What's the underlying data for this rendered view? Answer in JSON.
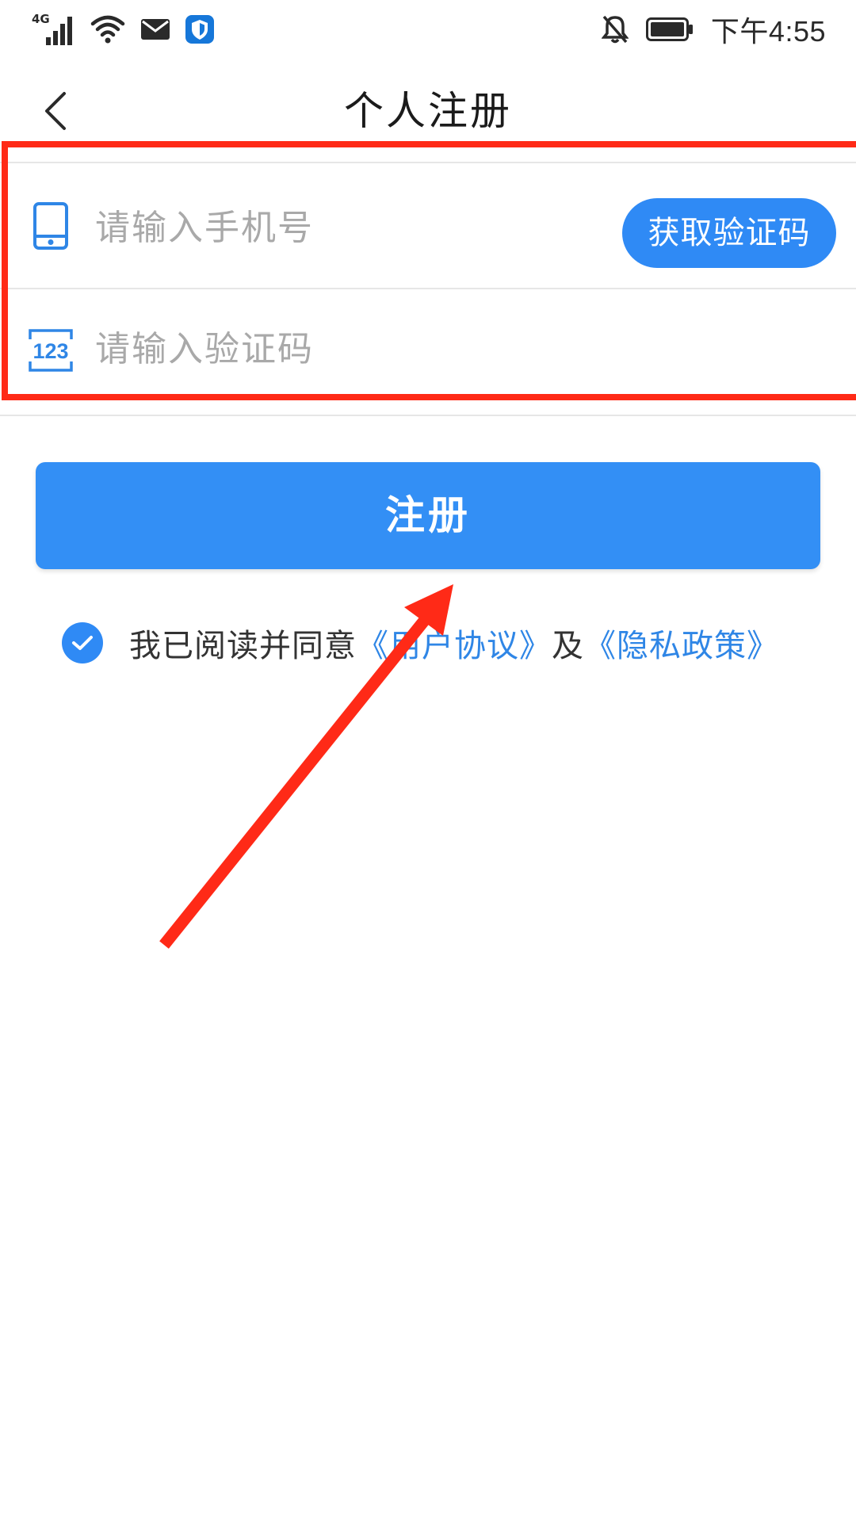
{
  "status_bar": {
    "network": "4G",
    "time": "下午4:55"
  },
  "header": {
    "title": "个人注册"
  },
  "form": {
    "phone_placeholder": "请输入手机号",
    "phone_value": "",
    "code_placeholder": "请输入验证码",
    "code_value": "",
    "get_code_label": "获取验证码"
  },
  "register": {
    "label": "注册"
  },
  "agreement": {
    "checked": true,
    "prefix": "我已阅读并同意",
    "user_agreement": "《用户协议》",
    "and": "及",
    "privacy_policy": "《隐私政策》"
  },
  "colors": {
    "accent": "#2f8af5",
    "link": "#2f86e6",
    "annotation": "#ff2a17"
  },
  "icons": {
    "back": "chevron-left-icon",
    "phone": "phone-icon",
    "code": "code-123-icon",
    "check": "check-icon"
  }
}
